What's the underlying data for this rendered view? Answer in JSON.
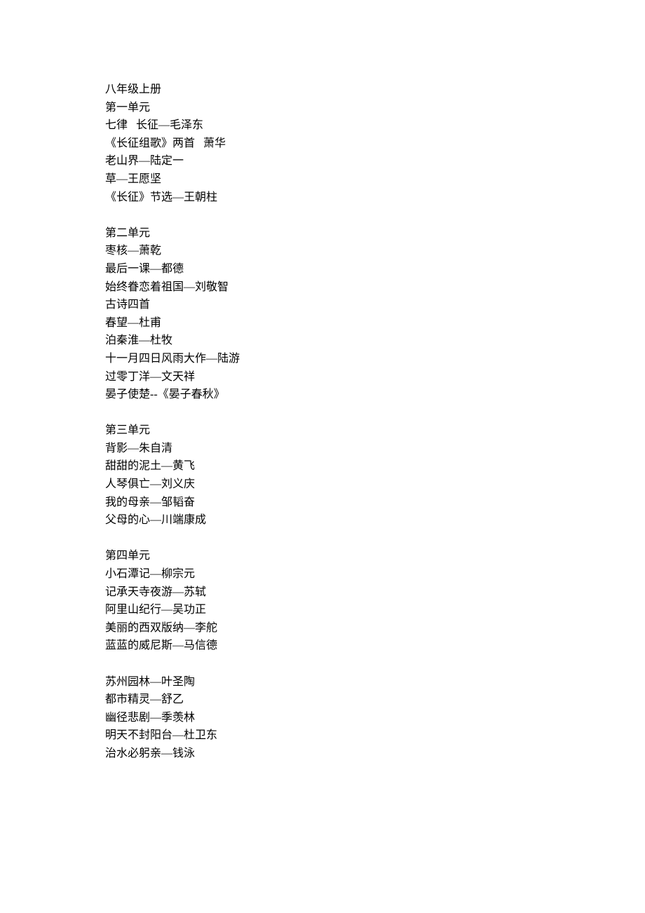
{
  "title": "八年级上册",
  "sections": [
    {
      "heading": "第一单元",
      "items": [
        "七律   长征—毛泽东",
        "《长征组歌》两首   萧华",
        "老山界—陆定一",
        "草—王愿坚",
        "《长征》节选—王朝柱"
      ]
    },
    {
      "heading": "第二单元",
      "items": [
        "枣核—萧乾",
        "最后一课—都德",
        "始终眷恋着祖国—刘敬智",
        "古诗四首",
        "春望—杜甫",
        "泊秦淮—杜牧",
        "十一月四日风雨大作—陆游",
        "过零丁洋—文天祥",
        "晏子使楚--《晏子春秋》"
      ]
    },
    {
      "heading": "第三单元",
      "items": [
        "背影—朱自清",
        "甜甜的泥土—黄飞",
        "人琴俱亡—刘义庆",
        "我的母亲—邹韬奋",
        "父母的心—川端康成"
      ]
    },
    {
      "heading": "第四单元",
      "items": [
        "小石潭记—柳宗元",
        "记承天寺夜游—苏轼",
        "阿里山纪行—吴功正",
        "美丽的西双版纳—李舵",
        "蓝蓝的威尼斯—马信德"
      ]
    },
    {
      "heading": "",
      "items": [
        "苏州园林—叶圣陶",
        "都市精灵—舒乙",
        "幽径悲剧—季羡林",
        "明天不封阳台—杜卫东",
        "治水必躬亲—钱泳"
      ]
    }
  ]
}
